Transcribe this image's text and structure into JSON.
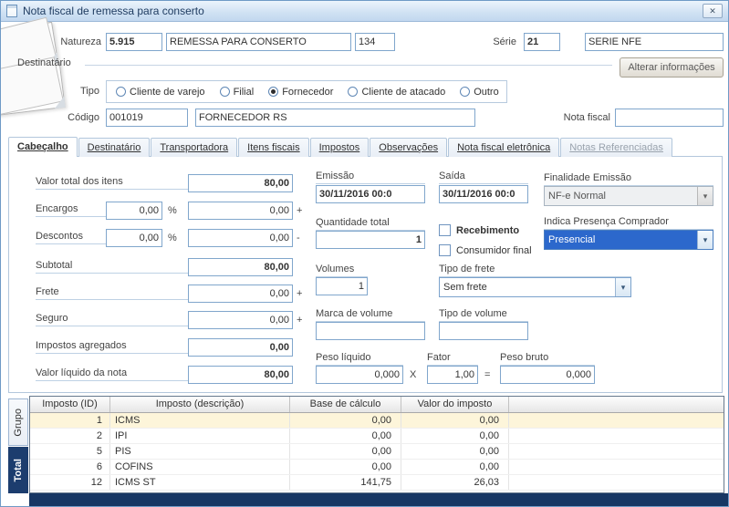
{
  "window": {
    "title": "Nota fiscal de remessa para conserto"
  },
  "icons": {
    "close": "✕",
    "chevron_down": "▾"
  },
  "symbols": {
    "percent": "%",
    "plus": "+",
    "minus": "-",
    "times": "X",
    "equals": "="
  },
  "colors": {
    "selection_blue": "#2c68cc",
    "total_navy": "#173663",
    "row_highlight": "#fdf5da"
  },
  "header": {
    "natureza_label": "Natureza",
    "natureza_code": "5.915",
    "natureza_desc": "REMESSA PARA CONSERTO",
    "natureza_cfop": "134",
    "serie_label": "Série",
    "serie_code": "21",
    "serie_desc": "SERIE NFE"
  },
  "destinatario": {
    "section_label": "Destinatário",
    "alterar_button": "Alterar informações",
    "tipo_label": "Tipo",
    "tipo_options": [
      {
        "label": "Cliente de varejo",
        "checked": false
      },
      {
        "label": "Filial",
        "checked": false
      },
      {
        "label": "Fornecedor",
        "checked": true
      },
      {
        "label": "Cliente de atacado",
        "checked": false
      },
      {
        "label": "Outro",
        "checked": false
      }
    ],
    "codigo_label": "Código",
    "codigo_value": "001019",
    "codigo_desc": "FORNECEDOR RS",
    "nota_fiscal_label": "Nota fiscal",
    "nota_fiscal_value": ""
  },
  "tabs": [
    {
      "label": "Cabeçalho",
      "active": true,
      "disabled": false
    },
    {
      "label": "Destinatário",
      "active": false,
      "disabled": false
    },
    {
      "label": "Transportadora",
      "active": false,
      "disabled": false
    },
    {
      "label": "Itens fiscais",
      "active": false,
      "disabled": false
    },
    {
      "label": "Impostos",
      "active": false,
      "disabled": false
    },
    {
      "label": "Observações",
      "active": false,
      "disabled": false
    },
    {
      "label": "Nota fiscal eletrônica",
      "active": false,
      "disabled": false
    },
    {
      "label": "Notas Referenciadas",
      "active": false,
      "disabled": true
    }
  ],
  "cab": {
    "valor_total_label": "Valor total dos itens",
    "valor_total": "80,00",
    "encargos_label": "Encargos",
    "encargos_pct": "0,00",
    "encargos_val": "0,00",
    "descontos_label": "Descontos",
    "descontos_pct": "0,00",
    "descontos_val": "0,00",
    "subtotal_label": "Subtotal",
    "subtotal": "80,00",
    "frete_label": "Frete",
    "frete_val": "0,00",
    "seguro_label": "Seguro",
    "seguro_val": "0,00",
    "impostos_label": "Impostos agregados",
    "impostos_val": "0,00",
    "liquido_label": "Valor líquido da nota",
    "liquido_val": "80,00",
    "emissao_label": "Emissão",
    "emissao_val": "30/11/2016 00:0",
    "saida_label": "Saída",
    "saida_val": "30/11/2016 00:0",
    "finalidade_label": "Finalidade Emissão",
    "finalidade_val": "NF-e Normal",
    "quantidade_label": "Quantidade total",
    "quantidade_val": "1",
    "recebimento_label": "Recebimento",
    "consumidor_label": "Consumidor final",
    "presenca_label": "Indica Presença Comprador",
    "presenca_val": "Presencial",
    "volumes_label": "Volumes",
    "volumes_val": "1",
    "tipo_frete_label": "Tipo de frete",
    "tipo_frete_val": "Sem frete",
    "marca_label": "Marca de volume",
    "marca_val": "",
    "tipo_volume_label": "Tipo de volume",
    "tipo_volume_val": "",
    "peso_liquido_label": "Peso líquido",
    "peso_liquido_val": "0,000",
    "fator_label": "Fator",
    "fator_val": "1,00",
    "peso_bruto_label": "Peso bruto",
    "peso_bruto_val": "0,000"
  },
  "grid": {
    "side_tabs": [
      {
        "label": "Grupo",
        "active": false
      },
      {
        "label": "Total",
        "active": true
      }
    ],
    "columns": [
      "Imposto (ID)",
      "Imposto (descrição)",
      "Base de cálculo",
      "Valor do imposto"
    ],
    "rows": [
      {
        "id": "1",
        "desc": "ICMS",
        "base": "0,00",
        "valor": "0,00"
      },
      {
        "id": "2",
        "desc": "IPI",
        "base": "0,00",
        "valor": "0,00"
      },
      {
        "id": "5",
        "desc": "PIS",
        "base": "0,00",
        "valor": "0,00"
      },
      {
        "id": "6",
        "desc": "COFINS",
        "base": "0,00",
        "valor": "0,00"
      },
      {
        "id": "12",
        "desc": "ICMS ST",
        "base": "141,75",
        "valor": "26,03"
      }
    ]
  }
}
